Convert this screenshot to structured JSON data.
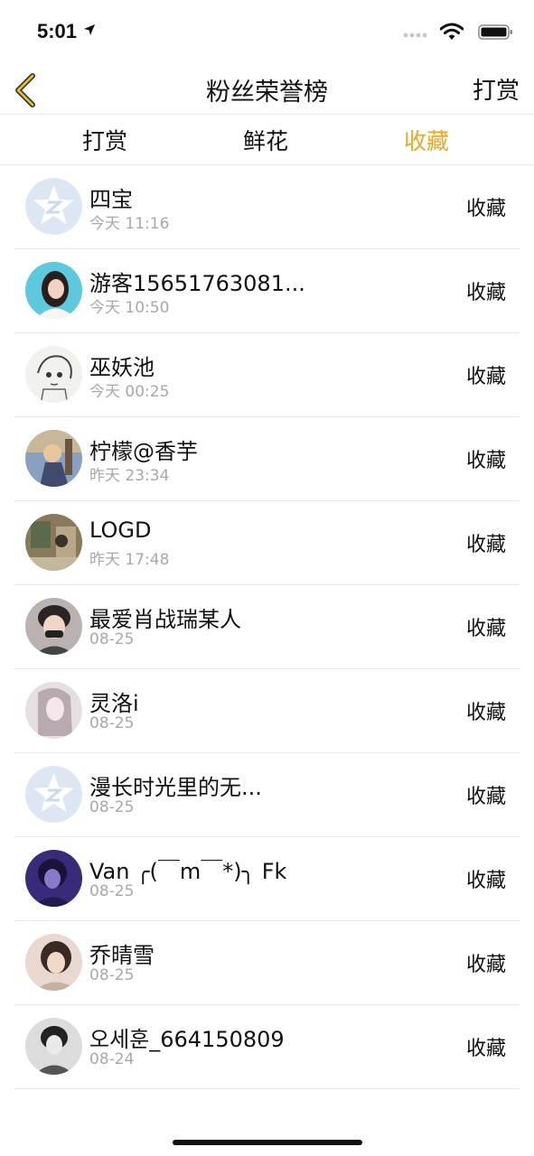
{
  "status_bar": {
    "time": "5:01"
  },
  "navbar": {
    "title": "粉丝荣誉榜",
    "right_label": "打赏"
  },
  "tabs": [
    {
      "label": "打赏",
      "active": false
    },
    {
      "label": "鲜花",
      "active": false
    },
    {
      "label": "收藏",
      "active": true
    }
  ],
  "accent_color": "#f0a623",
  "rows": [
    {
      "name": "四宝",
      "time": "今天 11:16",
      "action": "收藏",
      "avatar": "default-q-avatar"
    },
    {
      "name": "游客15651763081...",
      "time": "今天 10:50",
      "action": "收藏",
      "avatar": "photo-avatar"
    },
    {
      "name": "巫妖池",
      "time": "今天 00:25",
      "action": "收藏",
      "avatar": "sketch-avatar"
    },
    {
      "name": "柠檬@香芋",
      "time": "昨天 23:34",
      "action": "收藏",
      "avatar": "anime-avatar"
    },
    {
      "name": "LOGD",
      "time": "昨天 17:48",
      "action": "收藏",
      "avatar": "photo-avatar"
    },
    {
      "name": "最爱肖战瑞某人",
      "time": "08-25",
      "action": "收藏",
      "avatar": "photo-avatar"
    },
    {
      "name": "灵洛i",
      "time": "08-25",
      "action": "收藏",
      "avatar": "photo-avatar"
    },
    {
      "name": "漫长时光里的无...",
      "time": "08-25",
      "action": "收藏",
      "avatar": "default-q-avatar"
    },
    {
      "name": "Van ╭(￣m￣*)╮ Fk",
      "time": "08-25",
      "action": "收藏",
      "avatar": "photo-avatar"
    },
    {
      "name": "乔晴雪",
      "time": "08-25",
      "action": "收藏",
      "avatar": "photo-avatar"
    },
    {
      "name": "오세훈_664150809",
      "time": "08-24",
      "action": "收藏",
      "avatar": "photo-avatar"
    }
  ]
}
